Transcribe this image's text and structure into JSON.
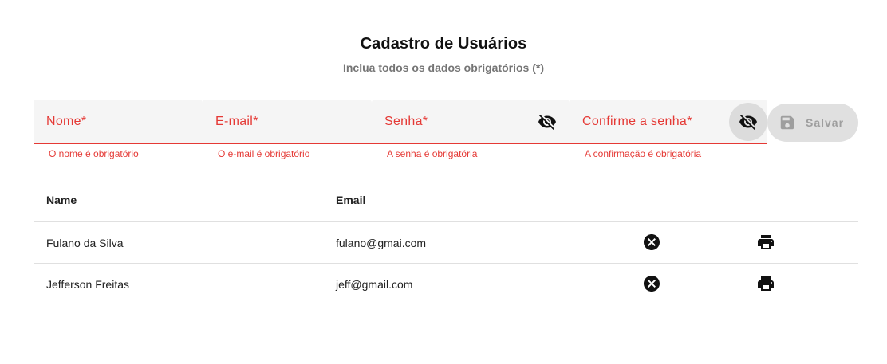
{
  "header": {
    "title": "Cadastro de Usuários",
    "subtitle": "Inclua todos os dados obrigatórios (*)"
  },
  "form": {
    "fields": [
      {
        "label": "Nome*",
        "error": "O nome é obrigatório"
      },
      {
        "label": "E-mail*",
        "error": "O e-mail é obrigatório"
      },
      {
        "label": "Senha*",
        "error": "A senha é obrigatória",
        "icon": "eye-off-icon"
      },
      {
        "label": "Confirme a senha*",
        "error": "A confirmação é obrigatória",
        "icon": "eye-off-icon"
      }
    ],
    "save_label": "Salvar",
    "save_icon": "save-icon",
    "error_color": "#e53935"
  },
  "table": {
    "columns": [
      "Name",
      "Email"
    ],
    "rows": [
      {
        "name": "Fulano da Silva",
        "email": "fulano@gmai.com"
      },
      {
        "name": "Jefferson Freitas",
        "email": "jeff@gmail.com"
      }
    ],
    "row_actions": [
      "cancel-icon",
      "print-icon"
    ]
  }
}
